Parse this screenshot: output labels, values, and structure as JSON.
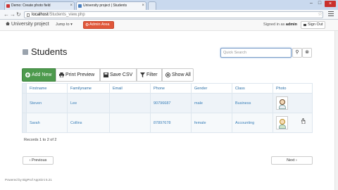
{
  "browser": {
    "tabs": [
      {
        "label": "Demo: Create photo field"
      },
      {
        "label": "University project | Students"
      }
    ],
    "url_host": "localhost",
    "url_path": "/Students_view.php"
  },
  "navbar": {
    "brand": "University project",
    "jump_to": "Jump to",
    "admin_area": "Admin Area",
    "signed_in_prefix": "Signed in as",
    "signed_in_user": "admin",
    "sign_out": "Sign Out"
  },
  "page": {
    "title": "Students",
    "search_placeholder": "Quick Search"
  },
  "toolbar": {
    "add_new": "Add New",
    "print_preview": "Print Preview",
    "save_csv": "Save CSV",
    "filter": "Filter",
    "show_all": "Show All"
  },
  "table": {
    "columns": [
      "Firstname",
      "Familyname",
      "Email",
      "Phone",
      "Gender",
      "Class",
      "Photo"
    ],
    "rows": [
      {
        "firstname": "Steven",
        "familyname": "Lee",
        "email": "",
        "phone": "90796687",
        "gender": "male",
        "class": "Business"
      },
      {
        "firstname": "Sarah",
        "familyname": "Collins",
        "email": "",
        "phone": "87897678",
        "gender": "female",
        "class": "Accounting"
      }
    ]
  },
  "records_text": "Records 1 to 2 of 2",
  "pagination": {
    "previous": "Previous",
    "next": "Next"
  },
  "footer": "Powered by BigProf AppGini 5.21",
  "colors": {
    "accent_green": "#4d9a4d",
    "admin_orange": "#e0573a",
    "link_blue": "#2a6ea6"
  }
}
